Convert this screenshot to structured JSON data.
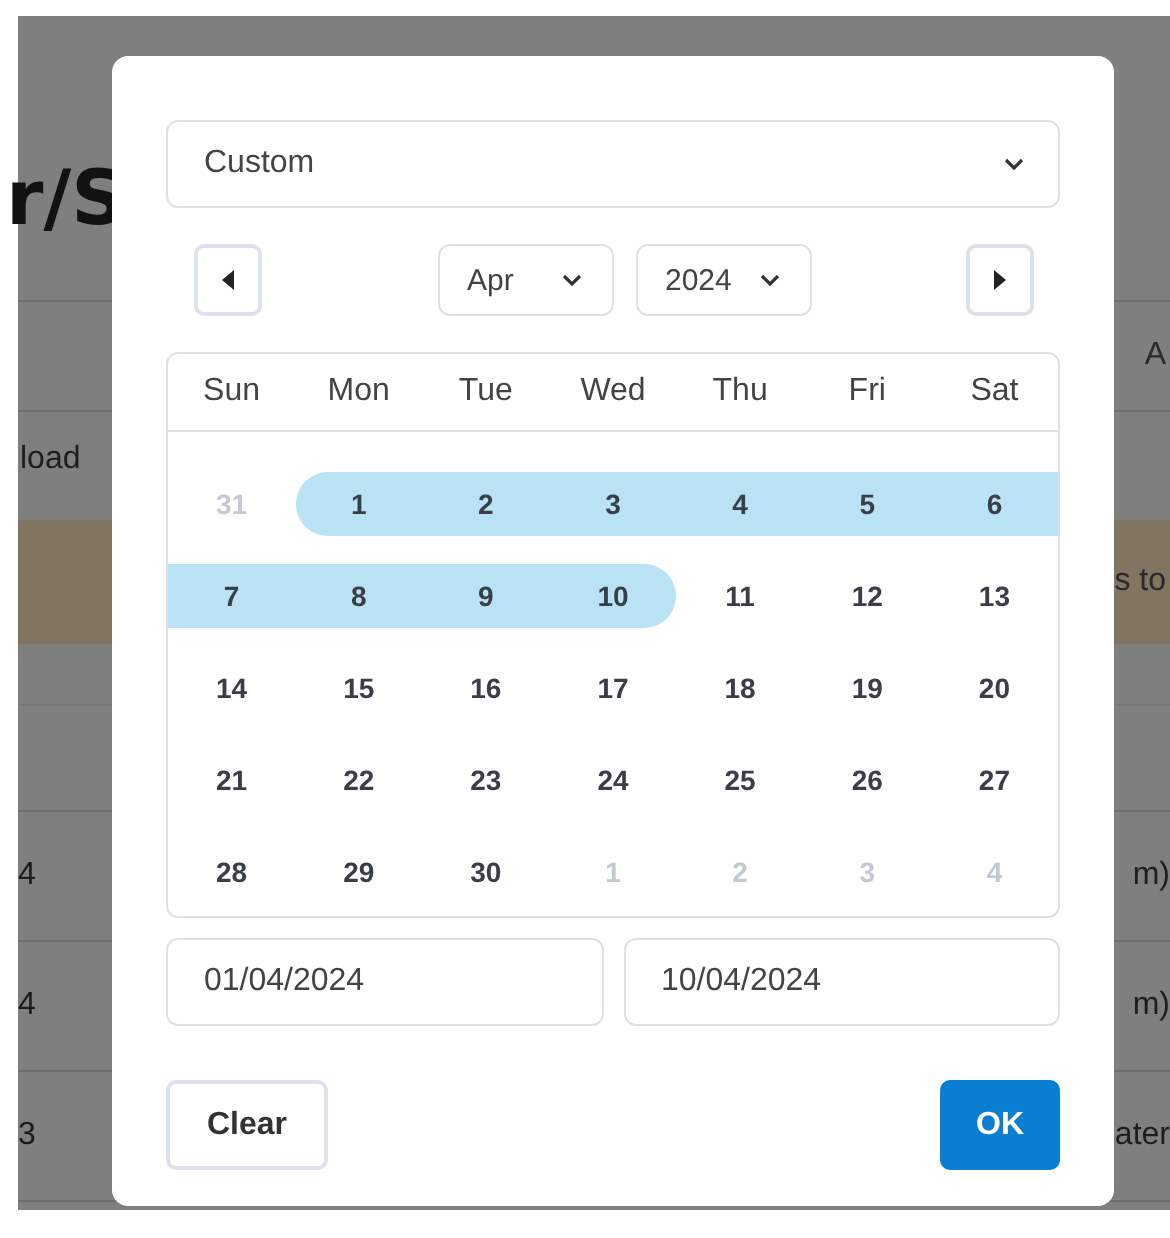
{
  "background": {
    "title": "r/S",
    "tab": "A",
    "toolbar_button": "load",
    "banner": "s to",
    "rows": [
      {
        "col_1": "4",
        "col_3": "m)"
      },
      {
        "col_1": "4",
        "col_3": "m)"
      },
      {
        "col_1": "3",
        "col_3": "ater"
      }
    ]
  },
  "modal": {
    "preset": {
      "value": "Custom"
    },
    "month": "Apr",
    "year": "2024",
    "weekdays": [
      "Sun",
      "Mon",
      "Tue",
      "Wed",
      "Thu",
      "Fri",
      "Sat"
    ],
    "weeks": [
      [
        {
          "label": "31",
          "outside": true,
          "in_range": false
        },
        {
          "label": "1",
          "outside": false,
          "in_range": true
        },
        {
          "label": "2",
          "outside": false,
          "in_range": true
        },
        {
          "label": "3",
          "outside": false,
          "in_range": true
        },
        {
          "label": "4",
          "outside": false,
          "in_range": true
        },
        {
          "label": "5",
          "outside": false,
          "in_range": true
        },
        {
          "label": "6",
          "outside": false,
          "in_range": true
        }
      ],
      [
        {
          "label": "7",
          "outside": false,
          "in_range": true
        },
        {
          "label": "8",
          "outside": false,
          "in_range": true
        },
        {
          "label": "9",
          "outside": false,
          "in_range": true
        },
        {
          "label": "10",
          "outside": false,
          "in_range": true
        },
        {
          "label": "11",
          "outside": false,
          "in_range": false
        },
        {
          "label": "12",
          "outside": false,
          "in_range": false
        },
        {
          "label": "13",
          "outside": false,
          "in_range": false
        }
      ],
      [
        {
          "label": "14",
          "outside": false,
          "in_range": false
        },
        {
          "label": "15",
          "outside": false,
          "in_range": false
        },
        {
          "label": "16",
          "outside": false,
          "in_range": false
        },
        {
          "label": "17",
          "outside": false,
          "in_range": false
        },
        {
          "label": "18",
          "outside": false,
          "in_range": false
        },
        {
          "label": "19",
          "outside": false,
          "in_range": false
        },
        {
          "label": "20",
          "outside": false,
          "in_range": false
        }
      ],
      [
        {
          "label": "21",
          "outside": false,
          "in_range": false
        },
        {
          "label": "22",
          "outside": false,
          "in_range": false
        },
        {
          "label": "23",
          "outside": false,
          "in_range": false
        },
        {
          "label": "24",
          "outside": false,
          "in_range": false
        },
        {
          "label": "25",
          "outside": false,
          "in_range": false
        },
        {
          "label": "26",
          "outside": false,
          "in_range": false
        },
        {
          "label": "27",
          "outside": false,
          "in_range": false
        }
      ],
      [
        {
          "label": "28",
          "outside": false,
          "in_range": false
        },
        {
          "label": "29",
          "outside": false,
          "in_range": false
        },
        {
          "label": "30",
          "outside": false,
          "in_range": false
        },
        {
          "label": "1",
          "outside": true,
          "in_range": false
        },
        {
          "label": "2",
          "outside": true,
          "in_range": false
        },
        {
          "label": "3",
          "outside": true,
          "in_range": false
        },
        {
          "label": "4",
          "outside": true,
          "in_range": false
        }
      ]
    ],
    "start_date": "01/04/2024",
    "end_date": "10/04/2024",
    "buttons": {
      "clear": "Clear",
      "ok": "OK"
    }
  }
}
